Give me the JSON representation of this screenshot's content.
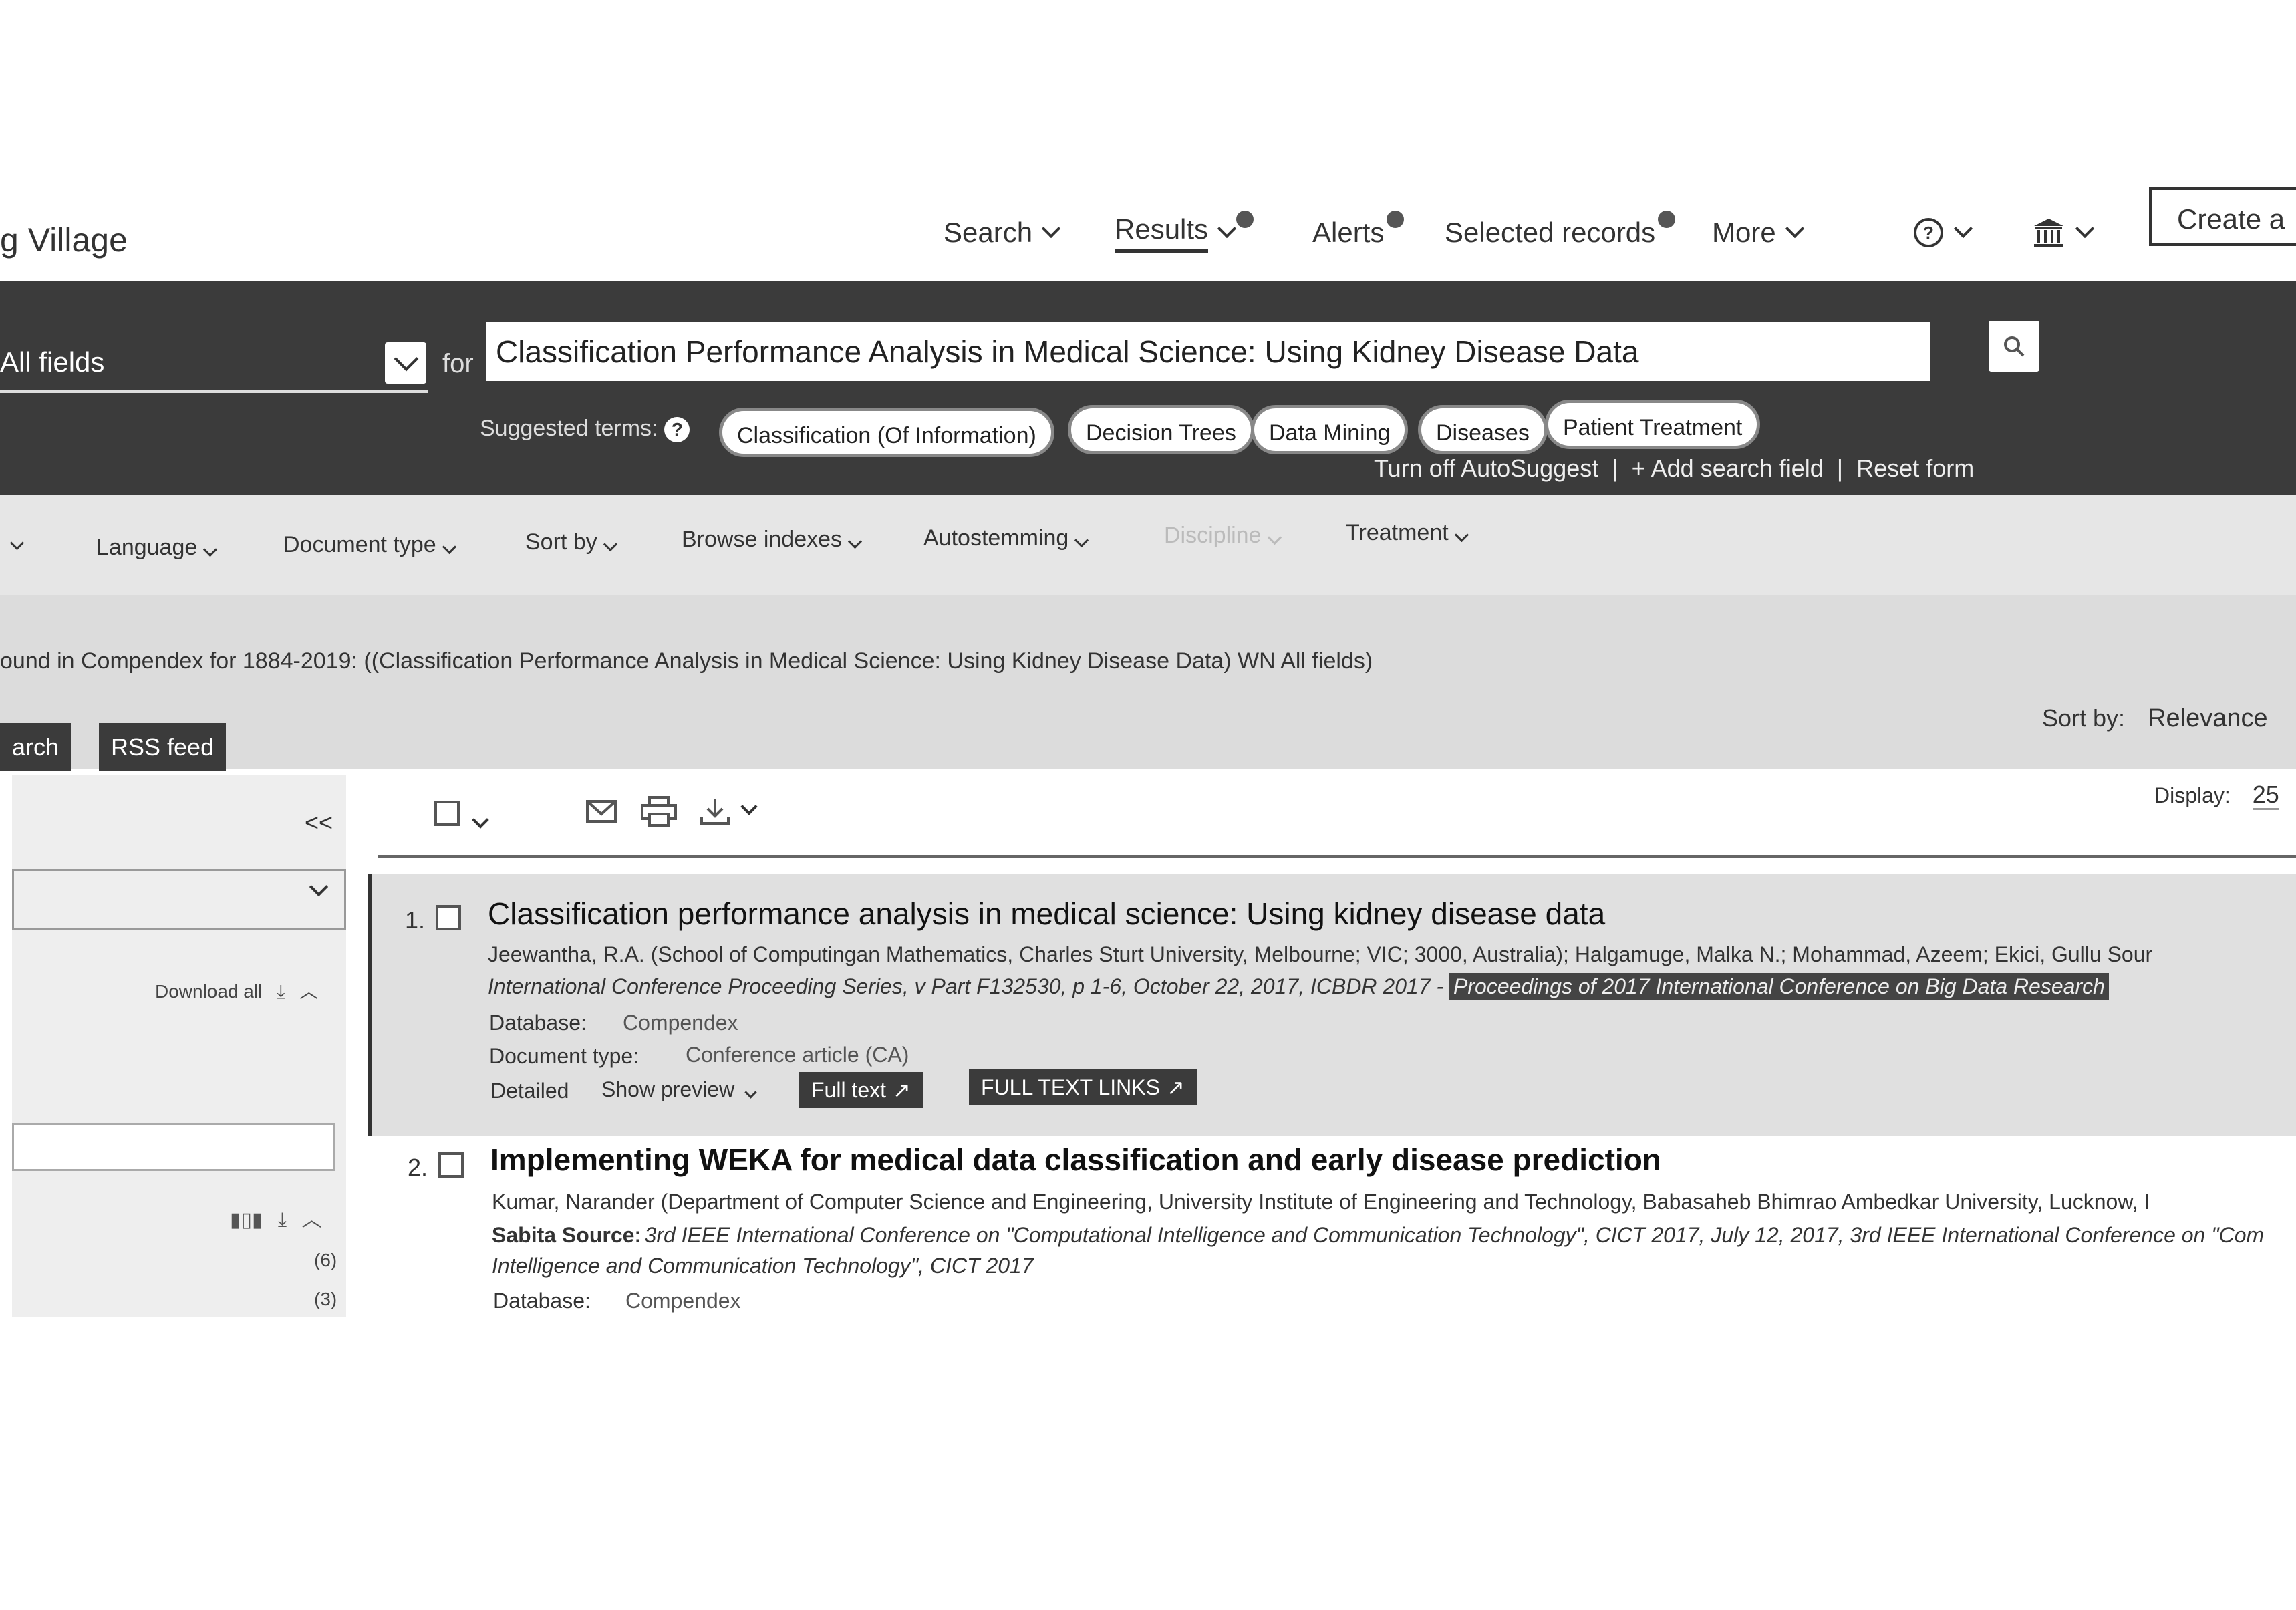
{
  "brand": "g Village",
  "nav": {
    "search": "Search",
    "results": "Results",
    "alerts": "Alerts",
    "selected_records": "Selected records",
    "more": "More",
    "help_icon": "help-icon",
    "institution_icon": "institution-icon",
    "create": "Create a"
  },
  "search": {
    "field": "All fields",
    "for_label": "for",
    "query": "Classification Performance Analysis in Medical Science: Using Kidney Disease Data",
    "suggested_label": "Suggested terms:",
    "suggested_terms": [
      "Classification (Of Information)",
      "Decision Trees",
      "Data Mining",
      "Diseases",
      "Patient Treatment"
    ],
    "turn_off_autosuggest": "Turn off AutoSuggest",
    "add_search_field": "+ Add search field",
    "reset_form": "Reset form"
  },
  "filters": [
    "Language",
    "Document type",
    "Sort by",
    "Browse indexes",
    "Autostemming",
    "Discipline",
    "Treatment"
  ],
  "results_header": {
    "found_text": "ound in Compendex for 1884-2019: ((Classification Performance Analysis in Medical Science: Using Kidney Disease Data) WN All fields)",
    "save_search": "arch",
    "rss_feed": "RSS feed",
    "sort_label": "Sort by:",
    "sort_value": "Relevance",
    "display_label": "Display:",
    "display_value": "25"
  },
  "left_panel": {
    "collapse": "<<",
    "download_all": "Download all",
    "counts": [
      "(6)",
      "(3)"
    ]
  },
  "results": [
    {
      "num": "1.",
      "title": "Classification performance analysis in medical science: Using kidney disease data",
      "authors": "Jeewantha, R.A. (School of Computingan Mathematics, Charles Sturt University, Melbourne; VIC; 3000, Australia); Halgamuge, Malka N.; Mohammad, Azeem; Ekici, Gullu Sour",
      "source": "International Conference Proceeding Series, v Part F132530, p 1-6, October 22, 2017, ICBDR 2017 -",
      "source_highlight": "Proceedings of 2017 International Conference on Big Data Research",
      "database_label": "Database:",
      "database": "Compendex",
      "doctype_label": "Document type:",
      "doctype": "Conference article (CA)",
      "detailed": "Detailed",
      "show_preview": "Show preview",
      "full_text": "Full text",
      "full_text_links": "FULL TEXT LINKS"
    },
    {
      "num": "2.",
      "title": "Implementing WEKA for medical data classification and early disease prediction",
      "authors": "Kumar, Narander (Department of Computer Science and Engineering, University Institute of Engineering and Technology, Babasaheb Bhimrao Ambedkar University, Lucknow, I",
      "source_label": "Sabita Source:",
      "source": "3rd IEEE International Conference on \"Computational Intelligence and Communication Technology\", CICT 2017, July 12, 2017, 3rd IEEE International Conference on \"Com",
      "source2": "Intelligence and Communication Technology\", CICT 2017",
      "database_label": "Database:",
      "database": "Compendex"
    }
  ]
}
